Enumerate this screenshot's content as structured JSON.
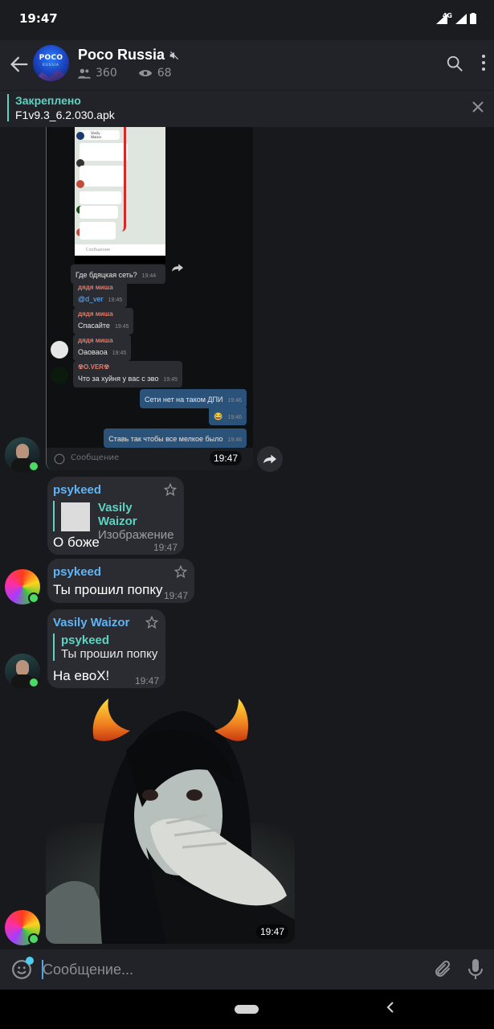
{
  "status": {
    "time": "19:47",
    "network": "4G"
  },
  "header": {
    "title": "Poco Russia",
    "avatar_title": "POCO",
    "avatar_sub": "RUSSIA",
    "members": "360",
    "views": "68",
    "muted": true
  },
  "pinned": {
    "label": "Закреплено",
    "value": "F1v9.3_6.2.030.apk"
  },
  "forwarded_screenshot": {
    "caption": "Где бдяцкая сеть?",
    "caption_time": "19:44",
    "messages": [
      {
        "name": "дядя миша",
        "text": "@d_ver",
        "time": "19:45"
      },
      {
        "name": "дядя миша",
        "text": "Спасайте",
        "time": "19:45"
      },
      {
        "name": "дядя миша",
        "text": "Оаоваоа",
        "time": "19:45"
      },
      {
        "name": "☢O.VER☢",
        "text": "Что за хуйня у вас с эво",
        "time": "19:45"
      }
    ],
    "outgoing": [
      {
        "text": "Сети нет на таком ДПИ",
        "time": "19:46"
      },
      {
        "text": "😂",
        "time": "19:46"
      },
      {
        "text": "Ставь так чтобы все мелкое было",
        "time": "19:46"
      }
    ],
    "inner_ph": "Сообщение",
    "inner_top": [
      "Vasily Waizor",
      "#Айфон10"
    ],
    "time": "19:47"
  },
  "messages": [
    {
      "sender": "psykeed",
      "reply_name": "Vasily Waizor",
      "reply_text": "Изображение",
      "text": "О боже",
      "time": "19:47"
    },
    {
      "sender": "psykeed",
      "text": "Ты прошил попку",
      "time": "19:47"
    },
    {
      "sender": "Vasily Waizor",
      "reply_name": "psykeed",
      "reply_text": "Ты прошил попку",
      "text": "На евоХ!",
      "time": "19:47"
    }
  ],
  "video": {
    "time": "19:47"
  },
  "composer": {
    "placeholder": "Сообщение..."
  },
  "colors": {
    "accent": "#5fd3c2",
    "link": "#5eb5f7",
    "online": "#4cd964",
    "bubble": "#2a2c31"
  }
}
